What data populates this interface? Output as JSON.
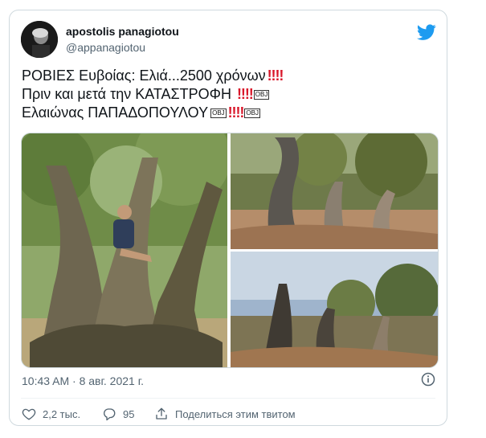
{
  "user": {
    "name": "apostolis panagiotou",
    "handle": "@appanagiotou"
  },
  "tweet": {
    "line1_text": "ΡΟΒΙΕΣ Ευβοίας: Ελιά...2500 χρόνων",
    "line2_text": "Πριν και μετά την ΚΑΤΑΣΤΡΟΦΗ ",
    "line3_text": "Ελαιώνας ΠΑΠΑΔΟΠΟΥΛΟΥ",
    "double_exclamation": "‼",
    "obj_marker": "OBJ"
  },
  "media": {
    "images": [
      "old-olive-tree-photo",
      "burned-olive-grove-photo-1",
      "burned-olive-grove-photo-2"
    ]
  },
  "meta": {
    "timestamp": "10:43 AM · 8 авг. 2021 г."
  },
  "actions": {
    "likes": "2,2 тыс.",
    "replies": "95",
    "share_label": "Поделиться этим твитом"
  },
  "icons": {
    "logo": "twitter-bird-icon",
    "info": "info-icon",
    "like": "heart-icon",
    "reply": "reply-icon",
    "share": "share-icon"
  },
  "colors": {
    "twitter_blue": "#1d9bf0",
    "text_primary": "#0f1419",
    "text_secondary": "#536471",
    "border": "#cfd9de",
    "exclamation_red": "#d9182b"
  }
}
